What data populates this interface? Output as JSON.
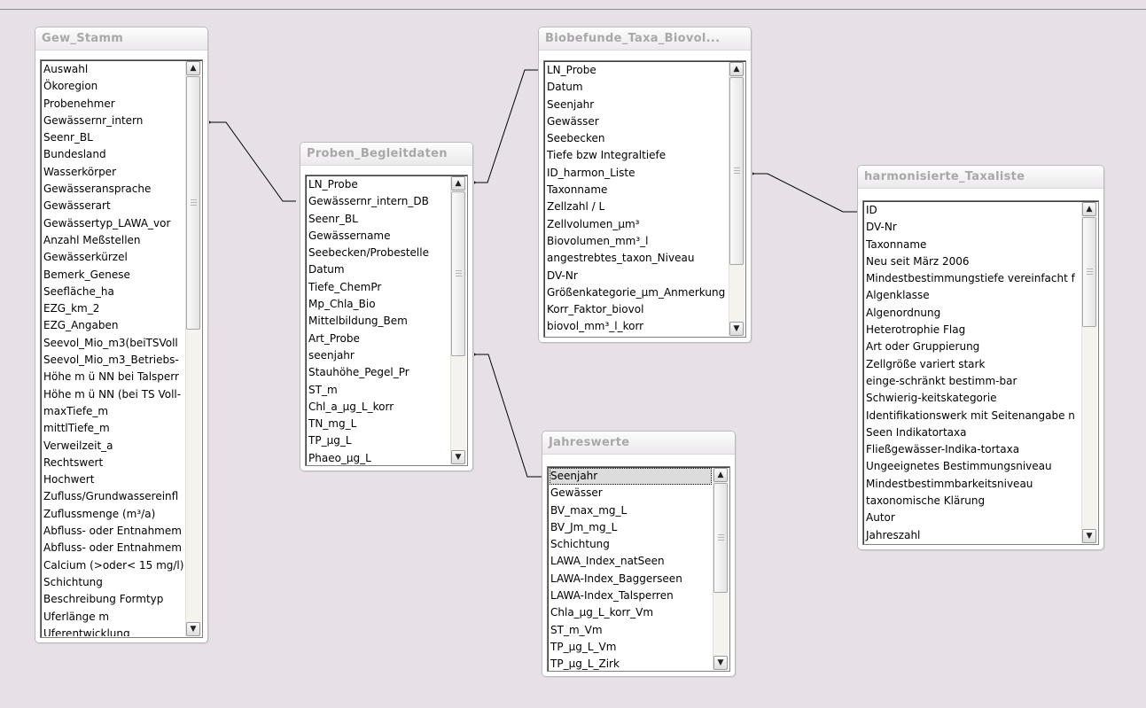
{
  "tables": {
    "gew_stamm": {
      "title": "Gew_Stamm",
      "fields": [
        "Auswahl",
        "Ökoregion",
        "Probenehmer",
        "Gewässernr_intern",
        "Seenr_BL",
        "Bundesland",
        "Wasserkörper",
        "Gewässeransprache",
        "Gewässerart",
        "Gewässertyp_LAWA_vor",
        "Anzahl Meßstellen",
        "Gewässerkürzel",
        "Bemerk_Genese",
        "Seefläche_ha",
        "EZG_km_2",
        "EZG_Angaben",
        "Seevol_Mio_m3(beiTSVoll",
        "Seevol_Mio_m3_Betriebs-",
        "Höhe m ü NN bei Talsperr",
        "Höhe m ü NN (bei TS Voll-",
        "maxTiefe_m",
        "mittlTiefe_m",
        "Verweilzeit_a",
        "Rechtswert",
        "Hochwert",
        "Zufluss/Grundwassereinfl",
        "Zuflussmenge (m³/a)",
        "Abfluss- oder Entnahmem",
        "Abfluss- oder Entnahmem",
        "Calcium (>oder< 15 mg/l)",
        "Schichtung",
        "Beschreibung Formtyp",
        "Uferlänge m",
        "Uferentwicklung"
      ]
    },
    "proben": {
      "title": "Proben_Begleitdaten",
      "fields": [
        "LN_Probe",
        "Gewässernr_intern_DB",
        "Seenr_BL",
        "Gewässername",
        "Seebecken/Probestelle",
        "Datum",
        "Tiefe_ChemPr",
        "Mp_Chla_Bio",
        "Mittelbildung_Bem",
        "Art_Probe",
        "seenjahr",
        "Stauhöhe_Pegel_Pr",
        "ST_m",
        "Chl_a_µg_L_korr",
        "TN_mg_L",
        "TP_µg_L",
        "Phaeo_µg_L"
      ]
    },
    "biobefunde": {
      "title": "Biobefunde_Taxa_Biovol...",
      "fields": [
        "LN_Probe",
        "Datum",
        "Seenjahr",
        "Gewässer",
        "Seebecken",
        "Tiefe bzw Integraltiefe",
        "ID_harmon_Liste",
        "Taxonname",
        "Zellzahl / L",
        "Zellvolumen_µm³",
        "Biovolumen_mm³_l",
        "angestrebtes_taxon_Niveau",
        "DV-Nr",
        "Größenkategorie_µm_Anmerkung",
        "Korr_Faktor_biovol",
        "biovol_mm³_l_korr"
      ]
    },
    "harmonisierte": {
      "title": "harmonisierte_Taxaliste",
      "fields": [
        "ID",
        "DV-Nr",
        "Taxonname",
        "Neu seit März 2006",
        "Mindestbestimmungstiefe vereinfacht f",
        "Algenklasse",
        "Algenordnung",
        "Heterotrophie Flag",
        "Art oder Gruppierung",
        "Zellgröße variert stark",
        "einge-schränkt bestimm-bar",
        "Schwierig-keitskategorie",
        "Identifikationswerk mit Seitenangabe n",
        "Seen Indikatortaxa",
        "Fließgewässer-Indika-tortaxa",
        "Ungeeignetes Bestimmungsniveau",
        "Mindestbestimmbarkeitsniveau",
        "taxonomische Klärung",
        "Autor",
        "Jahreszahl"
      ]
    },
    "jahreswerte": {
      "title": "Jahreswerte",
      "fields": [
        "Seenjahr",
        "Gewässer",
        "BV_max_mg_L",
        "BV_Jm_mg_L",
        "Schichtung",
        "LAWA_Index_natSeen",
        "LAWA-Index_Baggerseen",
        "LAWA-Index_Talsperren",
        "Chla_µg_L_korr_Vm",
        "ST_m_Vm",
        "TP_µg_L_Vm",
        "TP_µg_L_Zirk"
      ]
    }
  },
  "icons": {
    "scroll_up": "▲",
    "scroll_down": "▼"
  },
  "colors": {
    "canvas": "#e7e1e7",
    "title_text": "#a9a7a9"
  }
}
